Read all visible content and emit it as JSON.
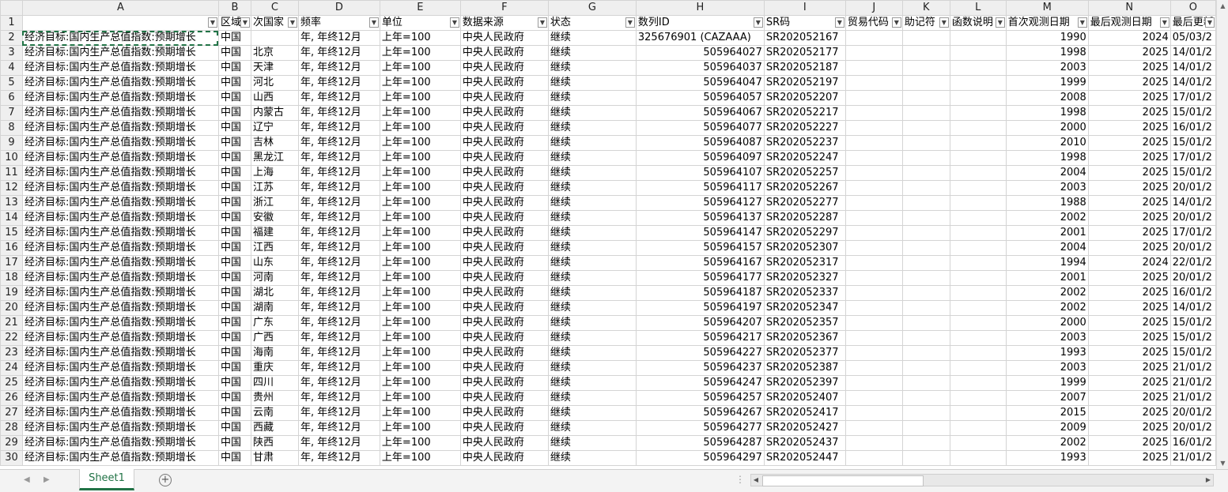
{
  "column_letters": [
    "A",
    "B",
    "C",
    "D",
    "E",
    "F",
    "G",
    "H",
    "I",
    "J",
    "K",
    "L",
    "M",
    "N",
    "O"
  ],
  "header_row": [
    "",
    "区域",
    "次国家",
    "频率",
    "单位",
    "数据来源",
    "状态",
    "数列ID",
    "SR码",
    "贸易代码",
    "助记符",
    "函数说明",
    "首次观测日期",
    "最后观测日期",
    "最后更新"
  ],
  "shared": {
    "name": "经济目标:国内生产总值指数:预期增长",
    "region": "中国",
    "frequency": "年, 年终12月",
    "unit": "上年=100",
    "source": "中央人民政府",
    "status": "继续"
  },
  "rows": [
    {
      "row": "2",
      "sub": "",
      "id": "325676901 (CAZAAA)",
      "sr": "SR202052167",
      "first": "1990",
      "last": "2024",
      "updated": "05/03/2"
    },
    {
      "row": "3",
      "sub": "北京",
      "id": "505964027",
      "sr": "SR202052177",
      "first": "1998",
      "last": "2025",
      "updated": "14/01/2"
    },
    {
      "row": "4",
      "sub": "天津",
      "id": "505964037",
      "sr": "SR202052187",
      "first": "2003",
      "last": "2025",
      "updated": "14/01/2"
    },
    {
      "row": "5",
      "sub": "河北",
      "id": "505964047",
      "sr": "SR202052197",
      "first": "1999",
      "last": "2025",
      "updated": "14/01/2"
    },
    {
      "row": "6",
      "sub": "山西",
      "id": "505964057",
      "sr": "SR202052207",
      "first": "2008",
      "last": "2025",
      "updated": "17/01/2"
    },
    {
      "row": "7",
      "sub": "内蒙古",
      "id": "505964067",
      "sr": "SR202052217",
      "first": "1998",
      "last": "2025",
      "updated": "15/01/2"
    },
    {
      "row": "8",
      "sub": "辽宁",
      "id": "505964077",
      "sr": "SR202052227",
      "first": "2000",
      "last": "2025",
      "updated": "16/01/2"
    },
    {
      "row": "9",
      "sub": "吉林",
      "id": "505964087",
      "sr": "SR202052237",
      "first": "2010",
      "last": "2025",
      "updated": "15/01/2"
    },
    {
      "row": "10",
      "sub": "黑龙江",
      "id": "505964097",
      "sr": "SR202052247",
      "first": "1998",
      "last": "2025",
      "updated": "17/01/2"
    },
    {
      "row": "11",
      "sub": "上海",
      "id": "505964107",
      "sr": "SR202052257",
      "first": "2004",
      "last": "2025",
      "updated": "15/01/2"
    },
    {
      "row": "12",
      "sub": "江苏",
      "id": "505964117",
      "sr": "SR202052267",
      "first": "2003",
      "last": "2025",
      "updated": "20/01/2"
    },
    {
      "row": "13",
      "sub": "浙江",
      "id": "505964127",
      "sr": "SR202052277",
      "first": "1988",
      "last": "2025",
      "updated": "14/01/2"
    },
    {
      "row": "14",
      "sub": "安徽",
      "id": "505964137",
      "sr": "SR202052287",
      "first": "2002",
      "last": "2025",
      "updated": "20/01/2"
    },
    {
      "row": "15",
      "sub": "福建",
      "id": "505964147",
      "sr": "SR202052297",
      "first": "2001",
      "last": "2025",
      "updated": "17/01/2"
    },
    {
      "row": "16",
      "sub": "江西",
      "id": "505964157",
      "sr": "SR202052307",
      "first": "2004",
      "last": "2025",
      "updated": "20/01/2"
    },
    {
      "row": "17",
      "sub": "山东",
      "id": "505964167",
      "sr": "SR202052317",
      "first": "1994",
      "last": "2024",
      "updated": "22/01/2"
    },
    {
      "row": "18",
      "sub": "河南",
      "id": "505964177",
      "sr": "SR202052327",
      "first": "2001",
      "last": "2025",
      "updated": "20/01/2"
    },
    {
      "row": "19",
      "sub": "湖北",
      "id": "505964187",
      "sr": "SR202052337",
      "first": "2002",
      "last": "2025",
      "updated": "16/01/2"
    },
    {
      "row": "20",
      "sub": "湖南",
      "id": "505964197",
      "sr": "SR202052347",
      "first": "2002",
      "last": "2025",
      "updated": "14/01/2"
    },
    {
      "row": "21",
      "sub": "广东",
      "id": "505964207",
      "sr": "SR202052357",
      "first": "2000",
      "last": "2025",
      "updated": "15/01/2"
    },
    {
      "row": "22",
      "sub": "广西",
      "id": "505964217",
      "sr": "SR202052367",
      "first": "2003",
      "last": "2025",
      "updated": "15/01/2"
    },
    {
      "row": "23",
      "sub": "海南",
      "id": "505964227",
      "sr": "SR202052377",
      "first": "1993",
      "last": "2025",
      "updated": "15/01/2"
    },
    {
      "row": "24",
      "sub": "重庆",
      "id": "505964237",
      "sr": "SR202052387",
      "first": "2003",
      "last": "2025",
      "updated": "21/01/2"
    },
    {
      "row": "25",
      "sub": "四川",
      "id": "505964247",
      "sr": "SR202052397",
      "first": "1999",
      "last": "2025",
      "updated": "21/01/2"
    },
    {
      "row": "26",
      "sub": "贵州",
      "id": "505964257",
      "sr": "SR202052407",
      "first": "2007",
      "last": "2025",
      "updated": "21/01/2"
    },
    {
      "row": "27",
      "sub": "云南",
      "id": "505964267",
      "sr": "SR202052417",
      "first": "2015",
      "last": "2025",
      "updated": "20/01/2"
    },
    {
      "row": "28",
      "sub": "西藏",
      "id": "505964277",
      "sr": "SR202052427",
      "first": "2009",
      "last": "2025",
      "updated": "20/01/2"
    },
    {
      "row": "29",
      "sub": "陕西",
      "id": "505964287",
      "sr": "SR202052437",
      "first": "2002",
      "last": "2025",
      "updated": "16/01/2"
    },
    {
      "row": "30",
      "sub": "甘肃",
      "id": "505964297",
      "sr": "SR202052447",
      "first": "1993",
      "last": "2025",
      "updated": "21/01/2"
    }
  ],
  "sheet_tabs": [
    "Sheet1"
  ],
  "add_sheet_label": "+"
}
